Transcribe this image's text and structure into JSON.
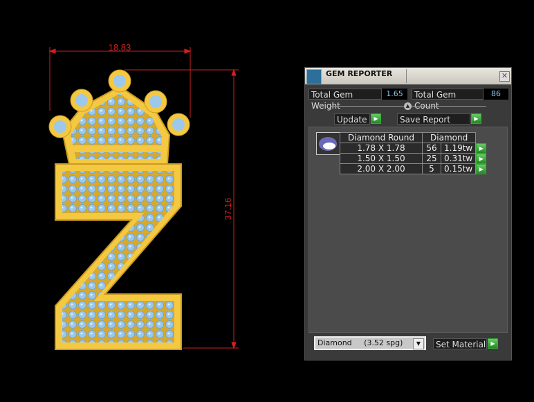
{
  "canvas": {
    "width_dimension": "18.83",
    "height_dimension": "37.16"
  },
  "panel": {
    "title": "GEM REPORTER",
    "total_weight_label": "Total Gem Weight",
    "total_weight_value": "1.65",
    "total_count_label": "Total Gem Count",
    "total_count_value": "86",
    "update_label": "Update",
    "save_report_label": "Save Report",
    "table": {
      "header_shape": "Diamond Round",
      "header_material": "Diamond",
      "rows": [
        {
          "size": "1.78 X 1.78",
          "count": "56",
          "weight": "1.19tw"
        },
        {
          "size": "1.50 X 1.50",
          "count": "25",
          "weight": "0.31tw"
        },
        {
          "size": "2.00 X 2.00",
          "count": "5",
          "weight": "0.15tw"
        }
      ]
    },
    "material_select": "Diamond     (3.52 spg)",
    "set_material_label": "Set Material"
  },
  "colors": {
    "gold": "#f5c842",
    "gem": "#9cc8ec",
    "dimension": "#d22020"
  }
}
